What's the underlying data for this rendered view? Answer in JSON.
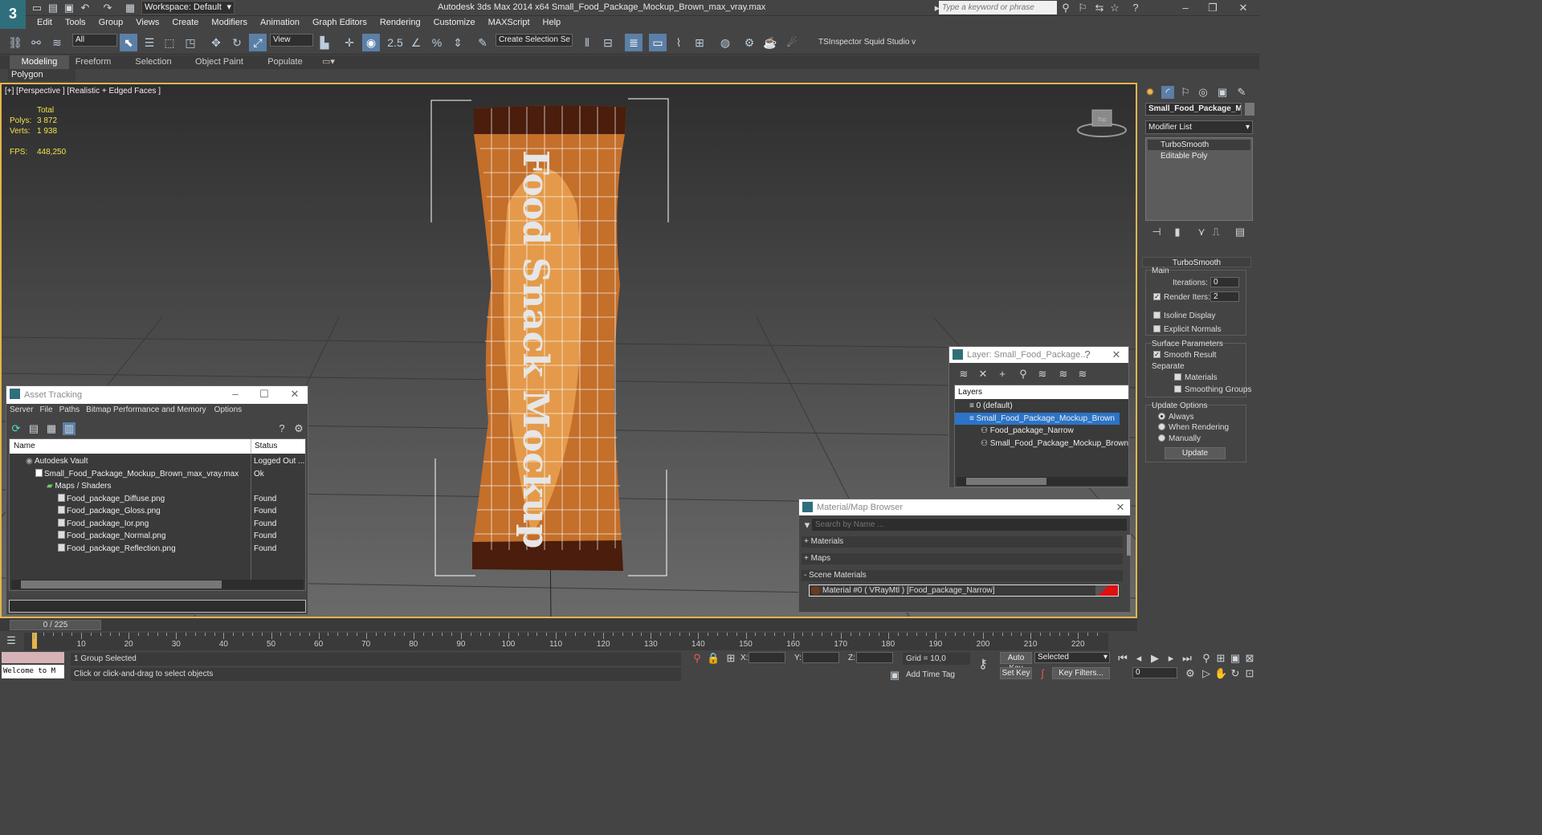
{
  "window": {
    "title": "Autodesk 3ds Max  2014 x64     Small_Food_Package_Mockup_Brown_max_vray.max",
    "workspace": "Workspace: Default",
    "search_placeholder": "Type a keyword or phrase"
  },
  "menu": [
    "Edit",
    "Tools",
    "Group",
    "Views",
    "Create",
    "Modifiers",
    "Animation",
    "Graph Editors",
    "Rendering",
    "Customize",
    "MAXScript",
    "Help"
  ],
  "toolbar": {
    "filter": "All",
    "ref_coord": "View",
    "selection_set": "Create Selection Se",
    "snaps": "2.5",
    "plugins": "TSInspector  Squid Studio v"
  },
  "ribbon": {
    "tabs": [
      "Modeling",
      "Freeform",
      "Selection",
      "Object Paint",
      "Populate"
    ],
    "panel": "Polygon Modeling"
  },
  "viewport": {
    "label": "[+] [Perspective ] [Realistic + Edged Faces ]",
    "stats": {
      "total_label": "Total",
      "polys_label": "Polys:",
      "polys": "3 872",
      "verts_label": "Verts:",
      "verts": "1 938",
      "fps_label": "FPS:",
      "fps": "448,250"
    },
    "package_text": "Food Snack Mockup",
    "viewcube": "Top"
  },
  "command_panel": {
    "object_name": "Small_Food_Package_Mc",
    "modifier_list": "Modifier List",
    "stack": [
      "TurboSmooth",
      "Editable Poly"
    ],
    "rollout": "TurboSmooth",
    "main_label": "Main",
    "iterations_label": "Iterations:",
    "iterations": "0",
    "render_iters_label": "Render Iters:",
    "render_iters": "2",
    "isoline": "Isoline Display",
    "explicit": "Explicit Normals",
    "surface_params": "Surface Parameters",
    "smooth_result": "Smooth Result",
    "separate": "Separate",
    "materials": "Materials",
    "smoothing_groups": "Smoothing Groups",
    "update_options": "Update Options",
    "always": "Always",
    "when_rendering": "When Rendering",
    "manually": "Manually",
    "update_btn": "Update"
  },
  "asset_tracking": {
    "title": "Asset Tracking",
    "menu": [
      "Server",
      "File",
      "Paths",
      "Bitmap Performance and Memory",
      "Options"
    ],
    "col_name": "Name",
    "col_status": "Status",
    "rows": [
      {
        "name": "Autodesk Vault",
        "status": "Logged Out ..."
      },
      {
        "name": "Small_Food_Package_Mockup_Brown_max_vray.max",
        "status": "Ok"
      },
      {
        "name": "Maps / Shaders",
        "status": ""
      },
      {
        "name": "Food_package_Diffuse.png",
        "status": "Found"
      },
      {
        "name": "Food_package_Gloss.png",
        "status": "Found"
      },
      {
        "name": "Food_package_Ior.png",
        "status": "Found"
      },
      {
        "name": "Food_package_Normal.png",
        "status": "Found"
      },
      {
        "name": "Food_package_Reflection.png",
        "status": "Found"
      }
    ]
  },
  "layer_window": {
    "title": "Layer: Small_Food_Package...",
    "help": "?",
    "col": "Layers",
    "rows": [
      "0 (default)",
      "Small_Food_Package_Mockup_Brown",
      "Food_package_Narrow",
      "Small_Food_Package_Mockup_Brown"
    ]
  },
  "material_browser": {
    "title": "Material/Map Browser",
    "search": "Search by Name ...",
    "sections": [
      "+ Materials",
      "+ Maps",
      "- Scene Materials"
    ],
    "item": "Material #0  ( VRayMtl )  [Food_package_Narrow]"
  },
  "timeline": {
    "frame": "0 / 225",
    "ticks": [
      "10",
      "20",
      "30",
      "40",
      "50",
      "60",
      "70",
      "80",
      "90",
      "100",
      "110",
      "120",
      "130",
      "140",
      "150",
      "160",
      "170",
      "180",
      "190",
      "200",
      "210",
      "220"
    ]
  },
  "status": {
    "maxscript": "Welcome to M",
    "selected": "1 Group Selected",
    "prompt": "Click or click-and-drag to select objects",
    "x_label": "X:",
    "y_label": "Y:",
    "z_label": "Z:",
    "grid": "Grid = 10,0",
    "add_time_tag": "Add Time Tag",
    "auto_key": "Auto Key",
    "set_key": "Set Key",
    "selected_dd": "Selected",
    "key_filters": "Key Filters...",
    "frame_field": "0"
  }
}
